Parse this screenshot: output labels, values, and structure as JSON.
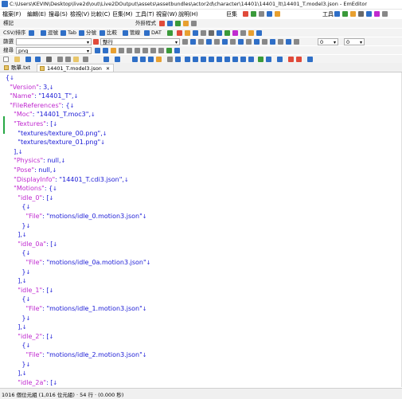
{
  "window": {
    "title": "C:\\Users\\KEVIN\\Desktop\\live2d\\out\\Live2DOutput\\assets\\assetbundles\\actor2d\\character\\14401\\14401_lt\\14401_T.model3.json - EmEditor"
  },
  "menu": {
    "items": [
      "檔案(F)",
      "編輯(E)",
      "搜尋(S)",
      "檢視(V)",
      "比較(C)",
      "巨集(M)",
      "工具(T)",
      "視窗(W)",
      "說明(H)"
    ],
    "right_items": [
      "巨集",
      "工具"
    ]
  },
  "toolbar1": {
    "label": "標記",
    "plugin_label": "外掛程式"
  },
  "toolbar2": {
    "items": [
      "CSV/排序",
      "逗號",
      "Tab",
      "分號",
      "比較",
      "管線",
      "DAT"
    ]
  },
  "toolbar3": {
    "find_label": "篩選",
    "find_value": "",
    "mode_value": "整行",
    "right_val1": "0",
    "right_val2": "0"
  },
  "toolbar4": {
    "search_label": "搜尋",
    "search_value": "png"
  },
  "tabs": [
    {
      "label": "歌單.txt",
      "active": false
    },
    {
      "label": "14401_T.model3.json",
      "active": true
    }
  ],
  "editor": {
    "lines": [
      [
        [
          "pun",
          "{"
        ],
        [
          "eol",
          "↓"
        ]
      ],
      [
        [
          "pun",
          "  "
        ],
        [
          "key",
          "\"Version\""
        ],
        [
          "pun",
          ": 3,"
        ],
        [
          "eol",
          "↓"
        ]
      ],
      [
        [
          "pun",
          "  "
        ],
        [
          "key",
          "\"Name\""
        ],
        [
          "pun",
          ": "
        ],
        [
          "str",
          "\"14401_T\""
        ],
        [
          "pun",
          ","
        ],
        [
          "eol",
          "↓"
        ]
      ],
      [
        [
          "pun",
          "  "
        ],
        [
          "key",
          "\"FileReferences\""
        ],
        [
          "pun",
          ": {"
        ],
        [
          "eol",
          "↓"
        ]
      ],
      [
        [
          "pun",
          "    "
        ],
        [
          "key",
          "\"Moc\""
        ],
        [
          "pun",
          ": "
        ],
        [
          "str",
          "\"14401_T.moc3\""
        ],
        [
          "pun",
          ","
        ],
        [
          "eol",
          "↓"
        ]
      ],
      [
        [
          "pun",
          "    "
        ],
        [
          "key",
          "\"Textures\""
        ],
        [
          "pun",
          ": ["
        ],
        [
          "eol",
          "↓"
        ]
      ],
      [
        [
          "pun",
          "      "
        ],
        [
          "str",
          "\"textures/texture_00.png\""
        ],
        [
          "pun",
          ","
        ],
        [
          "eol",
          "↓"
        ]
      ],
      [
        [
          "pun",
          "      "
        ],
        [
          "str",
          "\"textures/texture_01.png\""
        ],
        [
          "eol",
          "↓"
        ]
      ],
      [
        [
          "pun",
          "    ],"
        ],
        [
          "eol",
          "↓"
        ]
      ],
      [
        [
          "pun",
          "    "
        ],
        [
          "key",
          "\"Physics\""
        ],
        [
          "pun",
          ": null,"
        ],
        [
          "eol",
          "↓"
        ]
      ],
      [
        [
          "pun",
          "    "
        ],
        [
          "key",
          "\"Pose\""
        ],
        [
          "pun",
          ": null,"
        ],
        [
          "eol",
          "↓"
        ]
      ],
      [
        [
          "pun",
          "    "
        ],
        [
          "key",
          "\"DisplayInfo\""
        ],
        [
          "pun",
          ": "
        ],
        [
          "str",
          "\"14401_T.cdi3.json\""
        ],
        [
          "pun",
          ","
        ],
        [
          "eol",
          "↓"
        ]
      ],
      [
        [
          "pun",
          "    "
        ],
        [
          "key",
          "\"Motions\""
        ],
        [
          "pun",
          ": {"
        ],
        [
          "eol",
          "↓"
        ]
      ],
      [
        [
          "pun",
          "      "
        ],
        [
          "key",
          "\"idle_0\""
        ],
        [
          "pun",
          ": ["
        ],
        [
          "eol",
          "↓"
        ]
      ],
      [
        [
          "pun",
          "        {"
        ],
        [
          "eol",
          "↓"
        ]
      ],
      [
        [
          "pun",
          "          "
        ],
        [
          "key",
          "\"File\""
        ],
        [
          "pun",
          ": "
        ],
        [
          "str",
          "\"motions/idle_0.motion3.json\""
        ],
        [
          "eol",
          "↓"
        ]
      ],
      [
        [
          "pun",
          "        }"
        ],
        [
          "eol",
          "↓"
        ]
      ],
      [
        [
          "pun",
          "      ],"
        ],
        [
          "eol",
          "↓"
        ]
      ],
      [
        [
          "pun",
          "      "
        ],
        [
          "key",
          "\"idle_0a\""
        ],
        [
          "pun",
          ": ["
        ],
        [
          "eol",
          "↓"
        ]
      ],
      [
        [
          "pun",
          "        {"
        ],
        [
          "eol",
          "↓"
        ]
      ],
      [
        [
          "pun",
          "          "
        ],
        [
          "key",
          "\"File\""
        ],
        [
          "pun",
          ": "
        ],
        [
          "str",
          "\"motions/idle_0a.motion3.json\""
        ],
        [
          "eol",
          "↓"
        ]
      ],
      [
        [
          "pun",
          "        }"
        ],
        [
          "eol",
          "↓"
        ]
      ],
      [
        [
          "pun",
          "      ],"
        ],
        [
          "eol",
          "↓"
        ]
      ],
      [
        [
          "pun",
          "      "
        ],
        [
          "key",
          "\"idle_1\""
        ],
        [
          "pun",
          ": ["
        ],
        [
          "eol",
          "↓"
        ]
      ],
      [
        [
          "pun",
          "        {"
        ],
        [
          "eol",
          "↓"
        ]
      ],
      [
        [
          "pun",
          "          "
        ],
        [
          "key",
          "\"File\""
        ],
        [
          "pun",
          ": "
        ],
        [
          "str",
          "\"motions/idle_1.motion3.json\""
        ],
        [
          "eol",
          "↓"
        ]
      ],
      [
        [
          "pun",
          "        }"
        ],
        [
          "eol",
          "↓"
        ]
      ],
      [
        [
          "pun",
          "      ],"
        ],
        [
          "eol",
          "↓"
        ]
      ],
      [
        [
          "pun",
          "      "
        ],
        [
          "key",
          "\"idle_2\""
        ],
        [
          "pun",
          ": ["
        ],
        [
          "eol",
          "↓"
        ]
      ],
      [
        [
          "pun",
          "        {"
        ],
        [
          "eol",
          "↓"
        ]
      ],
      [
        [
          "pun",
          "          "
        ],
        [
          "key",
          "\"File\""
        ],
        [
          "pun",
          ": "
        ],
        [
          "str",
          "\"motions/idle_2.motion3.json\""
        ],
        [
          "eol",
          "↓"
        ]
      ],
      [
        [
          "pun",
          "        }"
        ],
        [
          "eol",
          "↓"
        ]
      ],
      [
        [
          "pun",
          "      ],"
        ],
        [
          "eol",
          "↓"
        ]
      ],
      [
        [
          "pun",
          "      "
        ],
        [
          "key",
          "\"idle_2a\""
        ],
        [
          "pun",
          ": ["
        ],
        [
          "eol",
          "↓"
        ]
      ]
    ]
  },
  "statusbar": {
    "text": "1016 個位元組 (1,016 位元組) · 54 行 · (0.000 秒)"
  },
  "colors": {
    "key": "#c02ad0",
    "value": "#1b1bd6",
    "accent": "#2f6fc7"
  }
}
